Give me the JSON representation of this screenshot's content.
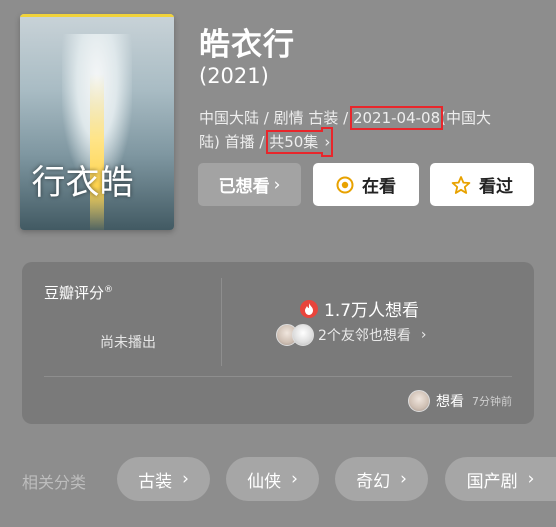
{
  "movie": {
    "title": "皓衣行",
    "year": "(2021)",
    "meta_line1_before": "中国大陆 / 剧情 古装 / ",
    "release_date": "2021-04-08",
    "meta_line1_after": "(中国大",
    "meta_line2_before": "陆) 首播 / ",
    "episodes": "共50集",
    "poster_calligraphy": "皓衣行"
  },
  "actions": {
    "wanted_label": "已想看",
    "watching_label": "在看",
    "watched_label": "看过"
  },
  "rating_card": {
    "label": "豆瓣评分",
    "label_mark": "®",
    "no_rating": "尚未播出",
    "want_count": "1.7万人想看",
    "friends_text": "2个友邻也想看",
    "activity_action": "想看",
    "activity_time": "7分钟前"
  },
  "related": {
    "label": "相关分类",
    "chips": [
      "古装",
      "仙侠",
      "奇幻",
      "国产剧"
    ]
  },
  "colors": {
    "background": "#8d8d8d",
    "highlight": "#e8262b",
    "watching_icon": "#e8a200",
    "watched_icon": "#e8a200",
    "flame": "#e8453c"
  },
  "icons": {
    "watching": "circle-dot-icon",
    "watched": "star-icon",
    "flame": "flame-icon",
    "chevron": "chevron-right-icon"
  }
}
